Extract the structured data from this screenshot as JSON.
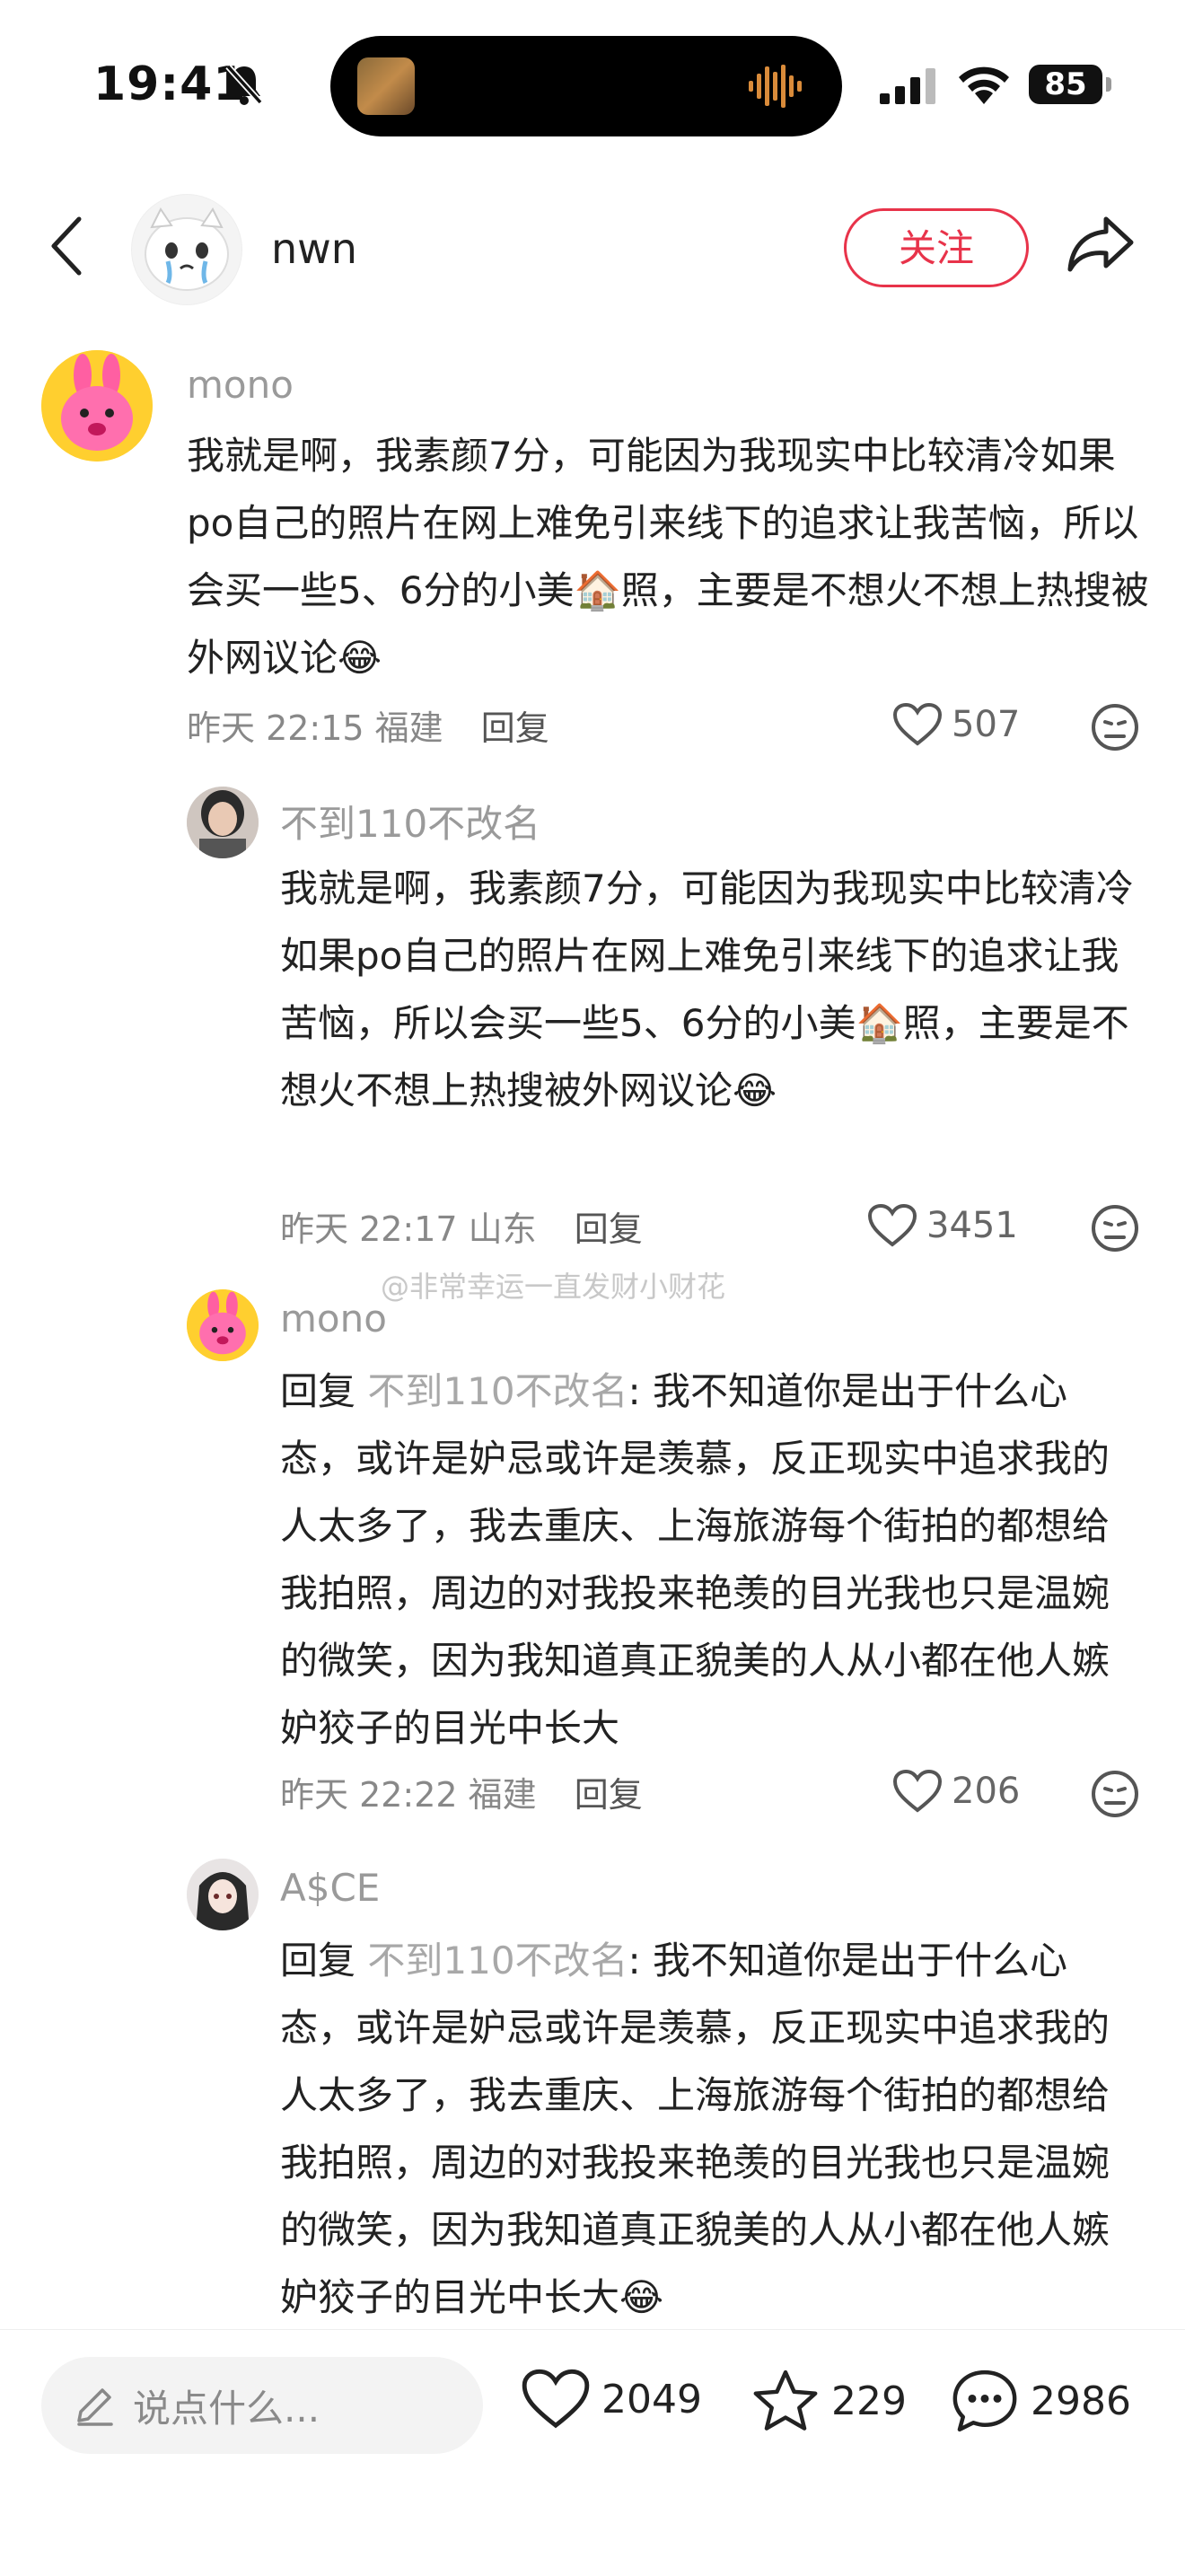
{
  "status_bar": {
    "time": "19:41",
    "battery": "85"
  },
  "header": {
    "username": "nwn",
    "follow_label": "关注"
  },
  "comments": [
    {
      "user": "mono",
      "text": "我就是啊，我素颜7分，可能因为我现实中比较清冷如果po自己的照片在网上难免引来线下的追求让我苦恼，所以会买一些5、6分的小美🏠照，主要是不想火不想上热搜被外网议论😂",
      "time_loc": "昨天 22:15 福建",
      "reply_label": "回复",
      "likes": "507"
    },
    {
      "user": "不到110不改名",
      "text": "我就是啊，我素颜7分，可能因为我现实中比较清冷如果po自己的照片在网上难免引来线下的追求让我苦恼，所以会买一些5、6分的小美🏠照，主要是不想火不想上热搜被外网议论😂",
      "time_loc": "昨天 22:17 山东",
      "reply_label": "回复",
      "likes": "3451"
    },
    {
      "user": "mono",
      "reply_prefix": "回复",
      "reply_to": "不到110不改名",
      "text": ": 我不知道你是出于什么心态，或许是妒忌或许是羡慕，反正现实中追求我的人太多了，我去重庆、上海旅游每个街拍的都想给我拍照，周边的对我投来艳羡的目光我也只是温婉的微笑，因为我知道真正貌美的人从小都在他人嫉妒狡子的目光中长大",
      "time_loc": "昨天 22:22 福建",
      "reply_label": "回复",
      "likes": "206"
    },
    {
      "user": "A$CE",
      "reply_prefix": "回复",
      "reply_to": "不到110不改名",
      "text": ": 我不知道你是出于什么心态，或许是妒忌或许是羡慕，反正现实中追求我的人太多了，我去重庆、上海旅游每个街拍的都想给我拍照，周边的对我投来艳羡的目光我也只是温婉的微笑，因为我知道真正貌美的人从小都在他人嫉妒狡子的目光中长大😂"
    }
  ],
  "watermark": "@非常幸运一直发财小财花",
  "bottom": {
    "placeholder": "说点什么...",
    "likes": "2049",
    "stars": "229",
    "comments": "2986"
  }
}
